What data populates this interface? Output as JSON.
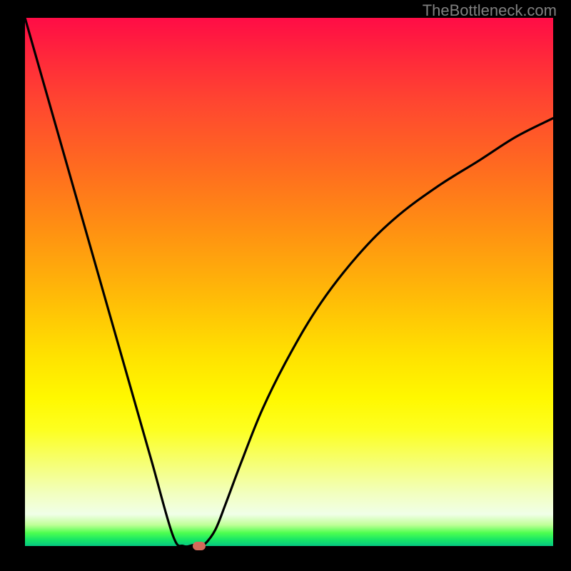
{
  "watermark": "TheBottleneck.com",
  "chart_data": {
    "type": "line",
    "title": "",
    "xlabel": "",
    "ylabel": "",
    "xlim": [
      0,
      100
    ],
    "ylim": [
      0,
      100
    ],
    "grid": false,
    "x": [
      0,
      2,
      5,
      8,
      12,
      16,
      20,
      24,
      28,
      30,
      32,
      33,
      34,
      36,
      38,
      41,
      45,
      50,
      56,
      63,
      70,
      78,
      86,
      93,
      100
    ],
    "values": [
      100,
      93,
      82.5,
      72,
      58,
      44,
      30,
      16,
      2,
      0,
      0.2,
      0,
      0.3,
      3,
      8,
      16,
      26,
      36,
      46,
      55,
      62,
      68,
      73,
      77.5,
      81
    ],
    "marker": {
      "x": 33,
      "y": 0
    },
    "colors": {
      "top": "#ff0c46",
      "mid": "#ffe200",
      "bottom": "#06c882",
      "curve": "#000000",
      "marker": "#d46a5a"
    }
  }
}
